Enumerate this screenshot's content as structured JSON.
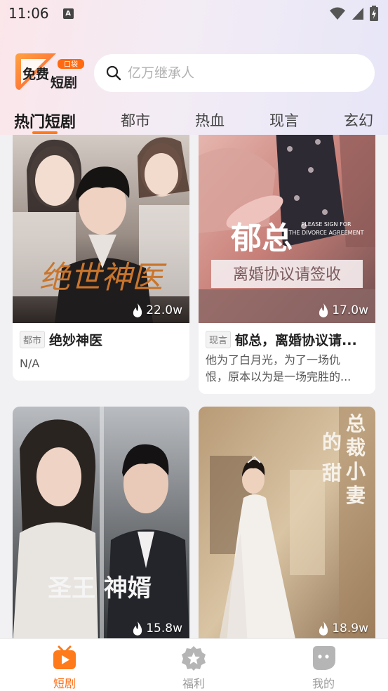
{
  "status_bar": {
    "time": "11:06",
    "a_icon": "A"
  },
  "header": {
    "logo": {
      "line1": "免费",
      "line2": "短剧",
      "badge": "口袋"
    },
    "search": {
      "placeholder": "亿万继承人"
    }
  },
  "tabs": [
    {
      "label": "热门短剧",
      "active": true
    },
    {
      "label": "都市",
      "active": false
    },
    {
      "label": "热血",
      "active": false
    },
    {
      "label": "现言",
      "active": false
    },
    {
      "label": "玄幻",
      "active": false
    }
  ],
  "cards": [
    {
      "poster_text": "绝世神医",
      "views": "22.0w",
      "tag": "都市",
      "title": "绝妙神医",
      "desc": "N/A"
    },
    {
      "poster_text": "郁总",
      "poster_sub": "离婚协议请签收",
      "poster_en1": "PLEASE SIGN FOR",
      "poster_en2": "THE DIVORCE AGREEMENT",
      "views": "17.0w",
      "tag": "现言",
      "title": "郁总，离婚协议请...",
      "desc_line1": "他为了白月光，为了一场仇",
      "desc_line2": "恨，原本以为是一场完胜的..."
    },
    {
      "poster_text": "圣王 神婿",
      "views": "15.8w"
    },
    {
      "poster_text": "总裁的小甜妻",
      "views": "18.9w"
    }
  ],
  "bottom_nav": [
    {
      "label": "短剧",
      "icon": "tv-play-icon",
      "active": true
    },
    {
      "label": "福利",
      "icon": "star-badge-icon",
      "active": false
    },
    {
      "label": "我的",
      "icon": "profile-icon",
      "active": false
    }
  ],
  "colors": {
    "accent": "#ff6a10",
    "tab_indicator": "#ff7a1a"
  }
}
